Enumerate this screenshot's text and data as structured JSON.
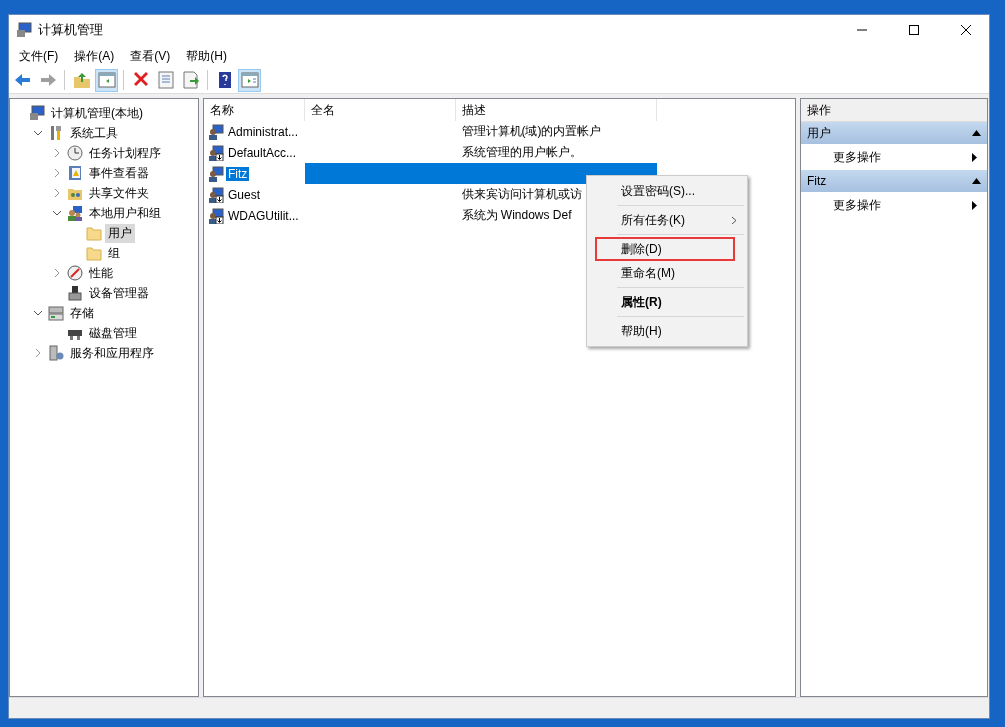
{
  "window": {
    "title": "计算机管理"
  },
  "menu_bar": [
    "文件(F)",
    "操作(A)",
    "查看(V)",
    "帮助(H)"
  ],
  "toolbar": [
    {
      "kind": "back",
      "disabled": false,
      "pressed": false
    },
    {
      "kind": "forward",
      "disabled": true,
      "pressed": false
    },
    {
      "kind": "sep"
    },
    {
      "kind": "up",
      "disabled": false,
      "pressed": false
    },
    {
      "kind": "tree",
      "disabled": false,
      "pressed": true
    },
    {
      "kind": "sep"
    },
    {
      "kind": "delete",
      "disabled": false,
      "pressed": false
    },
    {
      "kind": "properties",
      "disabled": false,
      "pressed": false
    },
    {
      "kind": "export",
      "disabled": false,
      "pressed": false
    },
    {
      "kind": "sep"
    },
    {
      "kind": "help",
      "disabled": false,
      "pressed": false
    },
    {
      "kind": "pane",
      "disabled": false,
      "pressed": true
    }
  ],
  "tree": [
    {
      "label": "计算机管理(本地)",
      "kind": "computer",
      "selected": false,
      "children": [
        {
          "label": "系统工具",
          "kind": "tools",
          "expanded": true,
          "selected": false,
          "children": [
            {
              "label": "任务计划程序",
              "kind": "clock",
              "expanded": false,
              "selected": false
            },
            {
              "label": "事件查看器",
              "kind": "log",
              "expanded": false,
              "selected": false
            },
            {
              "label": "共享文件夹",
              "kind": "share",
              "expanded": false,
              "selected": false
            },
            {
              "label": "本地用户和组",
              "kind": "users",
              "expanded": true,
              "selected": false,
              "children": [
                {
                  "label": "用户",
                  "kind": "folder",
                  "selected": true
                },
                {
                  "label": "组",
                  "kind": "folder",
                  "selected": false
                }
              ]
            },
            {
              "label": "性能",
              "kind": "gauge",
              "expanded": false,
              "selected": false
            },
            {
              "label": "设备管理器",
              "kind": "device",
              "selected": false
            }
          ]
        },
        {
          "label": "存储",
          "kind": "storage",
          "expanded": true,
          "selected": false,
          "children": [
            {
              "label": "磁盘管理",
              "kind": "disk",
              "selected": false
            }
          ]
        },
        {
          "label": "服务和应用程序",
          "kind": "services",
          "expanded": false,
          "selected": false
        }
      ]
    }
  ],
  "table": {
    "columns": [
      "名称",
      "全名",
      "描述"
    ],
    "rows": [
      {
        "name": "Administrat...",
        "description": "管理计算机(域)的内置帐户",
        "selected": false,
        "disabled": false
      },
      {
        "name": "DefaultAcc...",
        "description": "系统管理的用户帐户。",
        "selected": false,
        "disabled": true
      },
      {
        "name": "Fitz",
        "selected": true,
        "disabled": false
      },
      {
        "name": "Guest",
        "description": "供来宾访问计算机或访",
        "selected": false,
        "disabled": true
      },
      {
        "name": "WDAGUtilit...",
        "description": "系统为 Windows Def",
        "selected": false,
        "disabled": true
      }
    ]
  },
  "context_menu": [
    {
      "kind": "item",
      "label": "设置密码(S)...",
      "submenu": false,
      "default": false,
      "highlighted": false
    },
    {
      "kind": "separator"
    },
    {
      "kind": "item",
      "label": "所有任务(K)",
      "submenu": true,
      "default": false,
      "highlighted": false
    },
    {
      "kind": "separator"
    },
    {
      "kind": "item",
      "label": "删除(D)",
      "submenu": false,
      "default": false,
      "highlighted": true
    },
    {
      "kind": "item",
      "label": "重命名(M)",
      "submenu": false,
      "default": false,
      "highlighted": false
    },
    {
      "kind": "separator"
    },
    {
      "kind": "item",
      "label": "属性(R)",
      "submenu": false,
      "default": true,
      "highlighted": false
    },
    {
      "kind": "separator"
    },
    {
      "kind": "item",
      "label": "帮助(H)",
      "submenu": false,
      "default": false,
      "highlighted": false
    }
  ],
  "actions": {
    "title": "操作",
    "sections": [
      {
        "title": "用户",
        "expanded": true,
        "items": [
          "更多操作"
        ]
      },
      {
        "title": "Fitz",
        "expanded": true,
        "items": [
          "更多操作"
        ]
      }
    ]
  }
}
